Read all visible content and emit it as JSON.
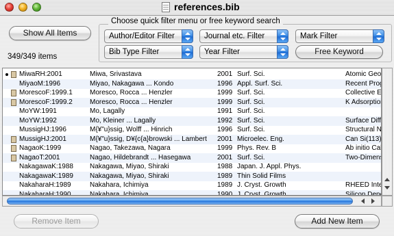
{
  "window": {
    "title": "references.bib",
    "icon": "bib-document-icon"
  },
  "toolbar": {
    "show_all_label": "Show All Items",
    "count_text": "349/349 items"
  },
  "search": {
    "group_label": "Choose quick filter menu or free keyword search",
    "author_filter": "Author/Editor Filter",
    "journal_filter": "Journal etc. Filter",
    "mark_filter": "Mark Filter",
    "bibtype_filter": "Bib Type Filter",
    "year_filter": "Year Filter",
    "free_keyword_label": "Free Keyword"
  },
  "table": {
    "rows": [
      {
        "key": "MiwaRH:2001",
        "authors": "Miwa, Srivastava",
        "year": "2001",
        "journal": "Surf. Sci.",
        "title": "Atomic Geom",
        "file": true,
        "marked": true
      },
      {
        "key": "MiyaoM:1996",
        "authors": "Miyao, Nakagawa ... Kondo",
        "year": "1996",
        "journal": "Appl. Surf. Sci.",
        "title": "Recent Prog",
        "file": false,
        "marked": false
      },
      {
        "key": "MorescoF:1999.1",
        "authors": "Moresco, Rocca ... Henzler",
        "year": "1999",
        "journal": "Surf. Sci.",
        "title": "Collective E:",
        "file": true,
        "marked": false
      },
      {
        "key": "MorescoF:1999.2",
        "authors": "Moresco, Rocca ... Henzler",
        "year": "1999",
        "journal": "Surf. Sci.",
        "title": "K Adsorption",
        "file": true,
        "marked": false
      },
      {
        "key": "MoYW:1991",
        "authors": "Mo, Lagally",
        "year": "1991",
        "journal": "Surf. Sci.",
        "title": "",
        "file": false,
        "marked": false
      },
      {
        "key": "MoYW:1992",
        "authors": "Mo, Kleiner ... Lagally",
        "year": "1992",
        "journal": "Surf. Sci.",
        "title": "Surface Diff",
        "file": false,
        "marked": false
      },
      {
        "key": "MussigHJ:1996",
        "authors": "M{¥\"u}ssig, Wolff ... Hinrich",
        "year": "1996",
        "journal": "Surf. Sci.",
        "title": "Structural N",
        "file": false,
        "marked": false
      },
      {
        "key": "MussigHJ:2001",
        "authors": "M{¥\"u}ssig, D¥{c{a}browski ... Lambert",
        "year": "2001",
        "journal": "Microelec. Eng.",
        "title": "Can Si(113)",
        "file": true,
        "marked": false
      },
      {
        "key": "NagaoK:1999",
        "authors": "Nagao, Takezawa, Nagara",
        "year": "1999",
        "journal": "Phys. Rev. B",
        "title": "Ab initio Cal",
        "file": true,
        "marked": false
      },
      {
        "key": "NagaoT:2001",
        "authors": "Nagao, Hildebrandt ... Hasegawa",
        "year": "2001",
        "journal": "Surf. Sci.",
        "title": "Two-Dimens",
        "file": true,
        "marked": false
      },
      {
        "key": "NakagawaK:1988",
        "authors": "Nakagawa, Miyao, Shiraki",
        "year": "1988",
        "journal": "Japan. J. Appl. Phys.",
        "title": "",
        "file": false,
        "marked": false
      },
      {
        "key": "NakagawaK:1989",
        "authors": "Nakagawa, Miyao, Shiraki",
        "year": "1989",
        "journal": "Thin Solid Films",
        "title": "",
        "file": false,
        "marked": false
      },
      {
        "key": "NakaharaH:1989",
        "authors": "Nakahara, Ichimiya",
        "year": "1989",
        "journal": "J. Cryst. Growth",
        "title": "RHEED Inten",
        "file": false,
        "marked": false
      },
      {
        "key": "NakaharaH:1990",
        "authors": "Nakahara, Ichimiya",
        "year": "1990",
        "journal": "J. Cryst. Growth",
        "title": "Silicon Depo",
        "file": false,
        "marked": false
      }
    ]
  },
  "footer": {
    "remove_label": "Remove Item",
    "add_label": "Add New Item"
  }
}
